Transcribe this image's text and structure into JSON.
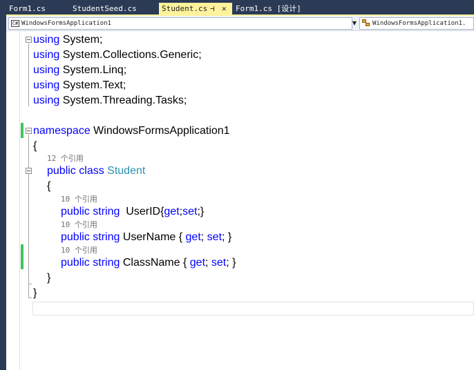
{
  "tabs": [
    {
      "label": "Form1.cs",
      "active": false
    },
    {
      "label": "StudentSeed.cs",
      "active": false
    },
    {
      "label": "Student.cs",
      "active": true,
      "pin": "⊣",
      "close": "✕"
    },
    {
      "label": "Form1.cs [设计]",
      "active": false
    }
  ],
  "nav": {
    "project": "WindowsFormsApplication1",
    "project_icon": "C#",
    "member": "WindowsFormsApplication1."
  },
  "code": {
    "l1": {
      "kw": "using",
      "rest": " System;"
    },
    "l2": {
      "kw": "using",
      "rest": " System.Collections.Generic;"
    },
    "l3": {
      "kw": "using",
      "rest": " System.Linq;"
    },
    "l4": {
      "kw": "using",
      "rest": " System.Text;"
    },
    "l5": {
      "kw": "using",
      "rest": " System.Threading.Tasks;"
    },
    "l7": {
      "kw": "namespace",
      "rest": " WindowsFormsApplication1"
    },
    "l8": "{",
    "hint_class": "12 个引用",
    "l9": {
      "kw1": "public",
      "kw2": " class ",
      "type": "Student"
    },
    "l10": "{",
    "hint_p1": "10 个引用",
    "l11": {
      "kw1": "public",
      "kw2": " string",
      "name": "  UserID{",
      "get": "get",
      "sep": ";",
      "set": "set",
      "tail": ";}"
    },
    "hint_p2": "10 个引用",
    "l12": {
      "kw1": "public",
      "kw2": " string",
      "name": " UserName { ",
      "get": "get",
      "sep": "; ",
      "set": "set",
      "tail": "; }"
    },
    "hint_p3": "10 个引用",
    "l13": {
      "kw1": "public",
      "kw2": " string",
      "name": " ClassName { ",
      "get": "get",
      "sep": "; ",
      "set": "set",
      "tail": "; }"
    },
    "l14": "}",
    "l15": "}"
  },
  "colors": {
    "keyword": "#0000ff",
    "type": "#2b91af",
    "hint": "#6f6f6f",
    "tab_active": "#fff29d",
    "chrome": "#2b3a55",
    "change": "#3ec45a"
  }
}
